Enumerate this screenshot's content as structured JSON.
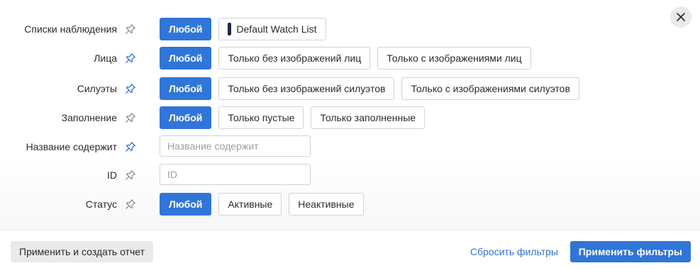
{
  "dialog": {
    "close_icon": "close-icon"
  },
  "filters": {
    "watchlists": {
      "label": "Списки наблюдения",
      "pinned": false,
      "options": [
        "Любой",
        "Default Watch List"
      ],
      "selected": "Любой",
      "watchlist_color": "#1d2a44"
    },
    "faces": {
      "label": "Лица",
      "pinned": true,
      "options": [
        "Любой",
        "Только без изображений лиц",
        "Только с изображениями лиц"
      ],
      "selected": "Любой"
    },
    "silhouettes": {
      "label": "Силуэты",
      "pinned": true,
      "options": [
        "Любой",
        "Только без изображений силуэтов",
        "Только с изображениями силуэтов"
      ],
      "selected": "Любой"
    },
    "filling": {
      "label": "Заполнение",
      "pinned": false,
      "options": [
        "Любой",
        "Только пустые",
        "Только заполненные"
      ],
      "selected": "Любой"
    },
    "name_contains": {
      "label": "Название содержит",
      "pinned": true,
      "value": "",
      "placeholder": "Название содержит"
    },
    "id": {
      "label": "ID",
      "pinned": false,
      "value": "",
      "placeholder": "ID"
    },
    "status": {
      "label": "Статус",
      "pinned": false,
      "options": [
        "Любой",
        "Активные",
        "Неактивные"
      ],
      "selected": "Любой"
    }
  },
  "footer": {
    "apply_and_report_label": "Применить и создать отчет",
    "reset_label": "Сбросить фильтры",
    "apply_label": "Применить фильтры"
  },
  "colors": {
    "accent": "#3075d8",
    "pin_active": "#2f73d4",
    "pin_inactive": "#8a8d91",
    "secondary_bg": "#e9eaeb"
  },
  "icons": {
    "pin": "pin-icon",
    "close": "close-icon"
  }
}
